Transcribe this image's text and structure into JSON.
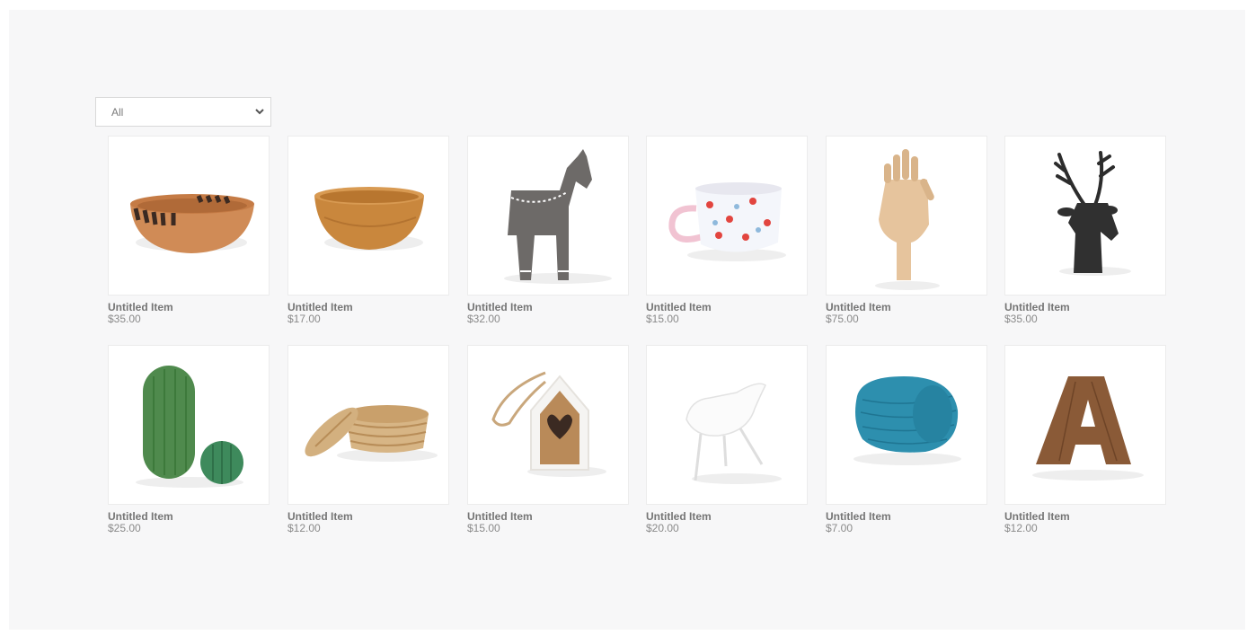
{
  "filter": {
    "selected": "All"
  },
  "products": [
    {
      "name": "Untitled Item",
      "price": "$35.00",
      "icon": "striped-wooden-bowl-icon"
    },
    {
      "name": "Untitled Item",
      "price": "$17.00",
      "icon": "bamboo-bowl-icon"
    },
    {
      "name": "Untitled Item",
      "price": "$32.00",
      "icon": "wooden-horse-icon"
    },
    {
      "name": "Untitled Item",
      "price": "$15.00",
      "icon": "floral-mug-icon"
    },
    {
      "name": "Untitled Item",
      "price": "$75.00",
      "icon": "wooden-hand-icon"
    },
    {
      "name": "Untitled Item",
      "price": "$35.00",
      "icon": "deer-head-icon"
    },
    {
      "name": "Untitled Item",
      "price": "$25.00",
      "icon": "ceramic-cactus-icon"
    },
    {
      "name": "Untitled Item",
      "price": "$12.00",
      "icon": "woven-basket-icon"
    },
    {
      "name": "Untitled Item",
      "price": "$15.00",
      "icon": "birdhouse-icon"
    },
    {
      "name": "Untitled Item",
      "price": "$20.00",
      "icon": "white-bird-icon"
    },
    {
      "name": "Untitled Item",
      "price": "$7.00",
      "icon": "yarn-ball-icon"
    },
    {
      "name": "Untitled Item",
      "price": "$12.00",
      "icon": "wooden-letter-a-icon"
    }
  ]
}
